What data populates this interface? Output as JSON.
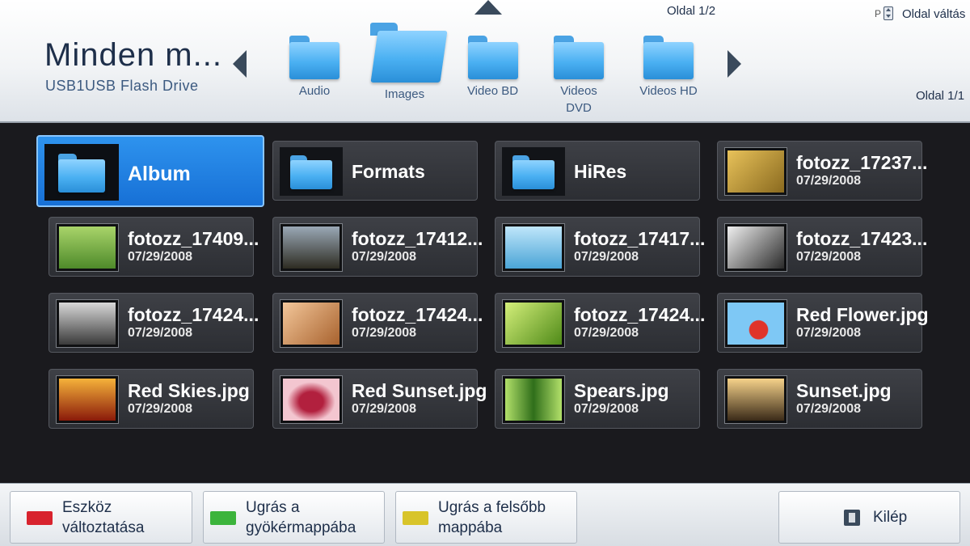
{
  "header": {
    "title": "Minden m...",
    "subtitle": "USB1USB Flash Drive",
    "page_top": "Oldal 1/2",
    "page_key": "P",
    "page_change": "Oldal váltás",
    "page_right": "Oldal 1/1",
    "folders": [
      {
        "label": "Audio"
      },
      {
        "label": "Images"
      },
      {
        "label": "Video BD"
      },
      {
        "label": "Videos DVD"
      },
      {
        "label": "Videos HD"
      }
    ]
  },
  "items": [
    {
      "name": "Album",
      "date": "",
      "type": "folder",
      "selected": true
    },
    {
      "name": "Formats",
      "date": "",
      "type": "folder"
    },
    {
      "name": "HiRes",
      "date": "",
      "type": "folder"
    },
    {
      "name": "fotozz_17237...",
      "date": "07/29/2008",
      "type": "image",
      "thumb_colors": [
        "#e8c25a",
        "#8a6a1f"
      ]
    },
    {
      "name": "fotozz_17409...",
      "date": "07/29/2008",
      "type": "image",
      "thumb_colors": [
        "#a9d46a",
        "#4e8a2a"
      ]
    },
    {
      "name": "fotozz_17412...",
      "date": "07/29/2008",
      "type": "image",
      "thumb_colors": [
        "#9aa8b6",
        "#2e2c22"
      ]
    },
    {
      "name": "fotozz_17417...",
      "date": "07/29/2008",
      "type": "image",
      "thumb_colors": [
        "#bfe6fa",
        "#4aa4d6"
      ]
    },
    {
      "name": "fotozz_17423...",
      "date": "07/29/2008",
      "type": "image",
      "thumb_colors": [
        "#f0f0f0",
        "#2a2a2a"
      ]
    },
    {
      "name": "fotozz_17424...",
      "date": "07/29/2008",
      "type": "image",
      "thumb_colors": [
        "#d8d8d8",
        "#3a3a3a"
      ]
    },
    {
      "name": "fotozz_17424...",
      "date": "07/29/2008",
      "type": "image",
      "thumb_colors": [
        "#f3c79a",
        "#a8622e"
      ]
    },
    {
      "name": "fotozz_17424...",
      "date": "07/29/2008",
      "type": "image",
      "thumb_colors": [
        "#d4ef7a",
        "#4f8a18"
      ]
    },
    {
      "name": "Red Flower.jpg",
      "date": "07/29/2008",
      "type": "image",
      "thumb_colors": [
        "#7ec8f5",
        "#e0342a"
      ]
    },
    {
      "name": "Red Skies.jpg",
      "date": "07/29/2008",
      "type": "image",
      "thumb_colors": [
        "#f5b23a",
        "#8a1a0a"
      ]
    },
    {
      "name": "Red Sunset.jpg",
      "date": "07/29/2008",
      "type": "image",
      "thumb_colors": [
        "#f3c6d0",
        "#b2203e"
      ]
    },
    {
      "name": "Spears.jpg",
      "date": "07/29/2008",
      "type": "image",
      "thumb_colors": [
        "#b2e06a",
        "#2f6e1a"
      ]
    },
    {
      "name": "Sunset.jpg",
      "date": "07/29/2008",
      "type": "image",
      "thumb_colors": [
        "#f6d28a",
        "#3a2a18"
      ]
    }
  ],
  "footer": {
    "red_label": "Eszköz változtatása",
    "green_label": "Ugrás a gyökérmappába",
    "yellow_label": "Ugrás a felsőbb mappába",
    "exit_label": "Kilép",
    "key_colors": {
      "red": "#d8232e",
      "green": "#3cb43c",
      "yellow": "#d8c42a"
    }
  }
}
